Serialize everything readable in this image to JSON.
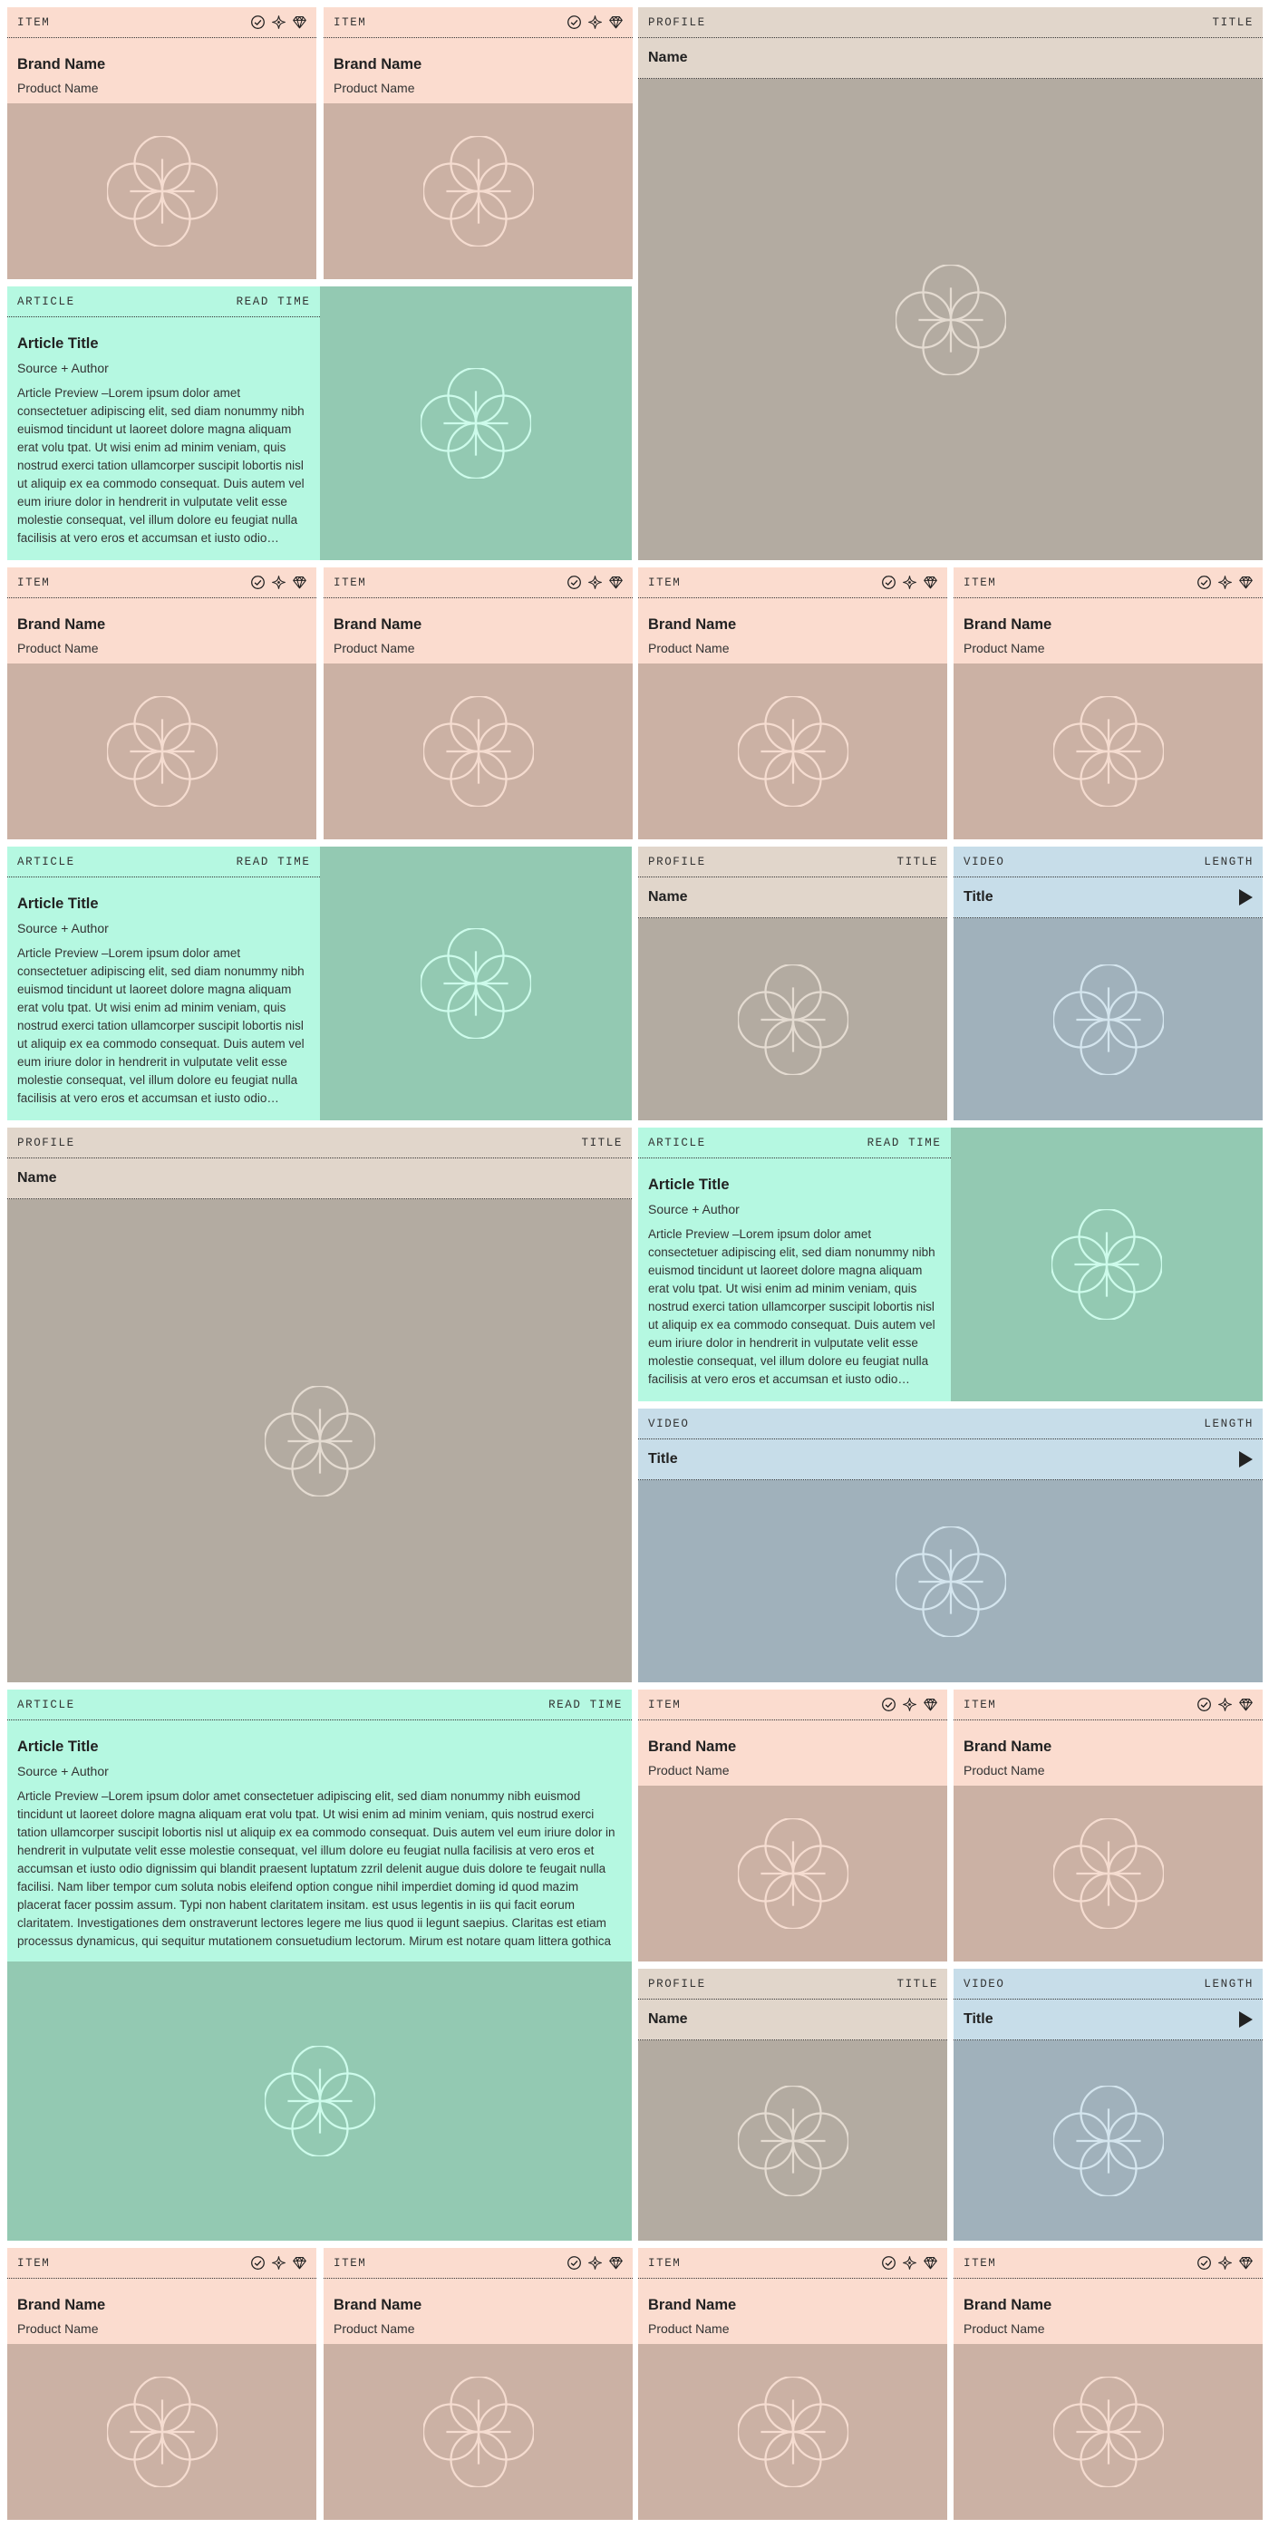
{
  "colors": {
    "item_bg": "#fbdccf",
    "item_media": "#cbb1a4",
    "item_flower": "#f5dcd0",
    "profile_bg": "#e1d6cb",
    "profile_media": "#b3aba1",
    "profile_flower": "#e4dbd1",
    "video_bg": "#c7dde9",
    "video_media": "#a0b1bb",
    "video_flower": "#d4e5ee",
    "article_bg": "#b5f8e1",
    "article_media": "#93c9b2",
    "article_flower": "#cdfbeb"
  },
  "icons": [
    "check-circle-icon",
    "sparkle-icon",
    "diamond-icon",
    "play-icon",
    "flower-icon"
  ],
  "item": {
    "tag": "ITEM",
    "brand": "Brand Name",
    "product": "Product Name"
  },
  "profile": {
    "tag": "PROFILE",
    "meta": "TITLE",
    "name": "Name"
  },
  "video": {
    "tag": "VIDEO",
    "meta": "LENGTH",
    "title": "Title"
  },
  "article": {
    "tag": "ARTICLE",
    "meta": "READ TIME",
    "title": "Article Title",
    "source": "Source + Author",
    "preview": "Article Preview –Lorem ipsum dolor amet consectetuer adipiscing elit, sed diam nonummy nibh euismod tincidunt ut laoreet dolore magna aliquam erat volu tpat. Ut wisi enim ad minim veniam, quis nostrud exerci tation ullamcorper suscipit lobortis nisl ut aliquip ex ea commodo consequat. Duis autem vel eum iriure dolor in hendrerit in vulputate velit esse molestie consequat, vel illum dolore eu feugiat nulla facilisis at vero eros et accumsan et iusto odio dignissim qui blandit praesent luptatum zzril delenit augue duis dolore te feugait nulla facilisi. Nam liber tempor cum soluta nobis eleifend option congue nihil imperdiet doming id quod mazim placerat facer possim assum. Typi non habent claritatem insitam. est usus legentis in iis qui facit eorum claritatem. Investigationes dem onstraverunt lectores legere me lius quod ii legunt saepius. Claritas est etiam processus dynamicus, qui sequitur mutationem consuetudium lectorum. Mirum est notare quam littera gothica"
  }
}
